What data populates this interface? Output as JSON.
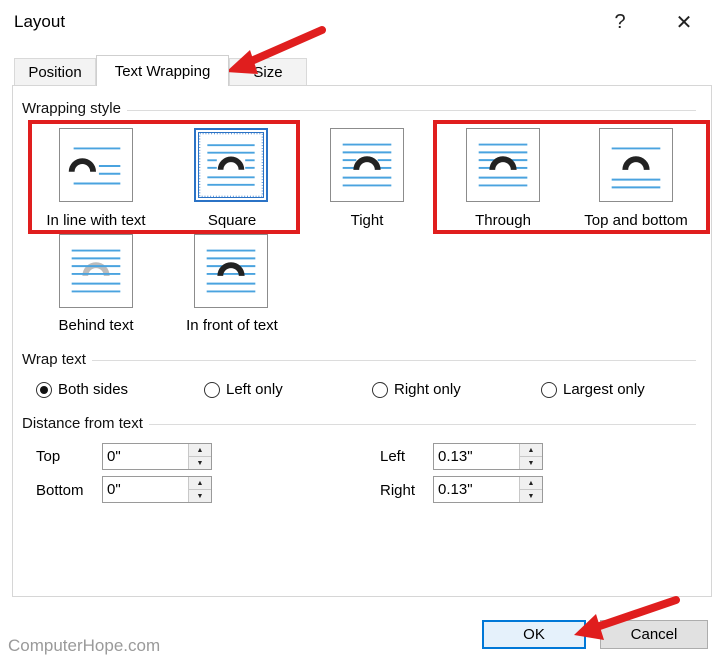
{
  "window": {
    "title": "Layout",
    "help_glyph": "?",
    "close_glyph": "✕"
  },
  "tabs": [
    {
      "label": "Position",
      "active": false
    },
    {
      "label": "Text Wrapping",
      "active": true
    },
    {
      "label": "Size",
      "active": false
    }
  ],
  "wrapping_style": {
    "heading": "Wrapping style",
    "options": [
      {
        "label": "In line with text",
        "icon": "inline-wrap-icon",
        "selected": false
      },
      {
        "label": "Square",
        "icon": "square-wrap-icon",
        "selected": true
      },
      {
        "label": "Tight",
        "icon": "tight-wrap-icon",
        "selected": false
      },
      {
        "label": "Through",
        "icon": "through-wrap-icon",
        "selected": false
      },
      {
        "label": "Top and bottom",
        "icon": "top-bottom-wrap-icon",
        "selected": false
      },
      {
        "label": "Behind text",
        "icon": "behind-text-icon",
        "selected": false
      },
      {
        "label": "In front of text",
        "icon": "in-front-text-icon",
        "selected": false
      }
    ]
  },
  "wrap_text": {
    "heading": "Wrap text",
    "options": [
      {
        "label": "Both sides",
        "checked": true
      },
      {
        "label": "Left only",
        "checked": false
      },
      {
        "label": "Right only",
        "checked": false
      },
      {
        "label": "Largest only",
        "checked": false
      }
    ]
  },
  "distance": {
    "heading": "Distance from text",
    "top": {
      "label": "Top",
      "value": "0\""
    },
    "bottom": {
      "label": "Bottom",
      "value": "0\""
    },
    "left": {
      "label": "Left",
      "value": "0.13\""
    },
    "right": {
      "label": "Right",
      "value": "0.13\""
    }
  },
  "footer": {
    "ok_label": "OK",
    "cancel_label": "Cancel",
    "watermark": "ComputerHope.com"
  },
  "colors": {
    "highlight_red": "#e01e1e",
    "line_blue": "#4aa3df",
    "selection_blue": "#2b73c6"
  }
}
